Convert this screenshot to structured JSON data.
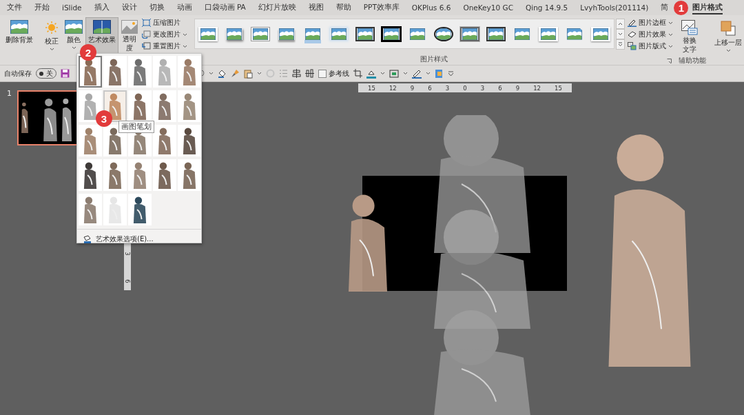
{
  "ribbon_tabs": [
    {
      "label": "文件",
      "selected": false
    },
    {
      "label": "开始",
      "selected": false
    },
    {
      "label": "iSlide",
      "selected": false
    },
    {
      "label": "插入",
      "selected": false
    },
    {
      "label": "设计",
      "selected": false
    },
    {
      "label": "切换",
      "selected": false
    },
    {
      "label": "动画",
      "selected": false
    },
    {
      "label": "口袋动画 PA",
      "selected": false
    },
    {
      "label": "幻灯片放映",
      "selected": false
    },
    {
      "label": "视图",
      "selected": false
    },
    {
      "label": "帮助",
      "selected": false
    },
    {
      "label": "PPT效率库",
      "selected": false
    },
    {
      "label": "OKPlus 6.6",
      "selected": false
    },
    {
      "label": "OneKey10 GC",
      "selected": false
    },
    {
      "label": "Qing 14.9.5",
      "selected": false
    },
    {
      "label": "LvyhTools(201114)",
      "selected": false
    },
    {
      "label": "简",
      "selected": false
    },
    {
      "label": "图片格式",
      "selected": true,
      "badge": "1"
    }
  ],
  "ribbon": {
    "remove_background": {
      "label": "删除背景"
    },
    "corrections": {
      "label": "校正"
    },
    "color": {
      "label": "颜色"
    },
    "artistic_effects": {
      "label": "艺术效果",
      "pressed": true,
      "badge": "2"
    },
    "transparency": {
      "label": "透明度"
    },
    "compress_pictures": {
      "label": "压缩图片"
    },
    "change_picture": {
      "label": "更改图片"
    },
    "reset_picture": {
      "label": "重置图片"
    },
    "picture_styles": {
      "group_label": "图片样式",
      "styles": [
        {
          "kind": "white-frame"
        },
        {
          "kind": "soft-shadow"
        },
        {
          "kind": "thin-frame"
        },
        {
          "kind": "drop-shadow"
        },
        {
          "kind": "reflected"
        },
        {
          "kind": "soft-edges"
        },
        {
          "kind": "black-frame"
        },
        {
          "kind": "thick-black"
        },
        {
          "kind": "plain"
        },
        {
          "kind": "oval"
        },
        {
          "kind": "metal-frame"
        },
        {
          "kind": "black-frame"
        },
        {
          "kind": "plain"
        },
        {
          "kind": "white-frame"
        },
        {
          "kind": "snip"
        },
        {
          "kind": "white-frame"
        }
      ]
    },
    "picture_border": {
      "label": "图片边框"
    },
    "picture_effects": {
      "label": "图片效果"
    },
    "picture_layout": {
      "label": "图片版式"
    },
    "alt_text": {
      "label": "替换文字",
      "group_label": "辅助功能"
    },
    "bring_forward": {
      "label": "上移一层"
    }
  },
  "quick_access": {
    "autosave_label": "自动保存",
    "autosave_toggle": {
      "label": "关",
      "on": false
    },
    "guides_checkbox": {
      "label": "参考线",
      "checked": false
    }
  },
  "slide_thumbnails": [
    {
      "number": "1",
      "selected": true
    }
  ],
  "horizontal_ruler": [
    "15",
    "12",
    "9",
    "6",
    "3",
    "0",
    "3",
    "6",
    "9",
    "12",
    "15"
  ],
  "vertical_ruler": [
    "3",
    "6"
  ],
  "art_effects_menu": {
    "effects": [
      {
        "selected": true,
        "hovered": false
      },
      {
        "selected": false,
        "hovered": false
      },
      {
        "selected": false,
        "hovered": false
      },
      {
        "selected": false,
        "hovered": false
      },
      {
        "selected": false,
        "hovered": false
      },
      {
        "selected": false,
        "hovered": false
      },
      {
        "selected": false,
        "hovered": true
      },
      {
        "selected": false,
        "hovered": false
      },
      {
        "selected": false,
        "hovered": false
      },
      {
        "selected": false,
        "hovered": false
      },
      {
        "selected": false,
        "hovered": false
      },
      {
        "selected": false,
        "hovered": false
      },
      {
        "selected": false,
        "hovered": false
      },
      {
        "selected": false,
        "hovered": false
      },
      {
        "selected": false,
        "hovered": false
      },
      {
        "selected": false,
        "hovered": false
      },
      {
        "selected": false,
        "hovered": false
      },
      {
        "selected": false,
        "hovered": false
      },
      {
        "selected": false,
        "hovered": false
      },
      {
        "selected": false,
        "hovered": false
      },
      {
        "selected": false,
        "hovered": false
      },
      {
        "selected": false,
        "hovered": false
      },
      {
        "selected": false,
        "hovered": false
      }
    ],
    "tooltip": {
      "text": "画图笔划",
      "badge": "3"
    },
    "options_item": "艺术效果选项(E)..."
  }
}
